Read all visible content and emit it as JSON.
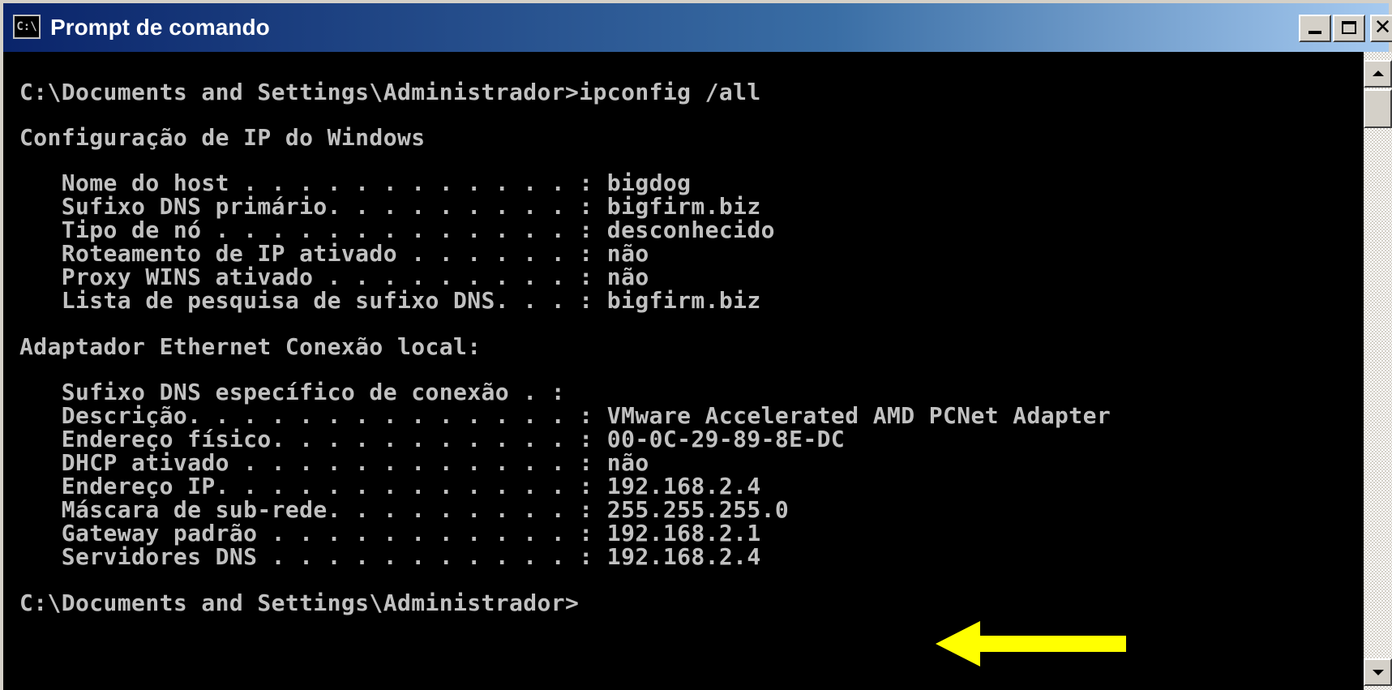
{
  "window": {
    "title": "Prompt de comando",
    "icon": "cmd-icon",
    "icon_text": "C:\\",
    "buttons": [
      "minimize-icon",
      "maximize-icon",
      "close-icon"
    ],
    "close_glyph": "✕"
  },
  "console": {
    "lines": [
      "C:\\Documents and Settings\\Administrador>ipconfig /all",
      "Configuração de IP do Windows",
      "   Nome do host . . . . . . . . . . . . : bigdog",
      "   Sufixo DNS primário. . . . . . . . . : bigfirm.biz",
      "   Tipo de nó . . . . . . . . . . . . . : desconhecido",
      "   Roteamento de IP ativado . . . . . . : não",
      "   Proxy WINS ativado . . . . . . . . . : não",
      "   Lista de pesquisa de sufixo DNS. . . : bigfirm.biz",
      "Adaptador Ethernet Conexão local:",
      "   Sufixo DNS específico de conexão . :",
      "   Descrição. . . . . . . . . . . . . . : VMware Accelerated AMD PCNet Adapter",
      "   Endereço físico. . . . . . . . . . . : 00-0C-29-89-8E-DC",
      "   DHCP ativado . . . . . . . . . . . . : não",
      "   Endereço IP. . . . . . . . . . . . . : 192.168.2.4",
      "   Máscara de sub-rede. . . . . . . . . : 255.255.255.0",
      "   Gateway padrão . . . . . . . . . . . : 192.168.2.1",
      "   Servidores DNS . . . . . . . . . . . : 192.168.2.4",
      "C:\\Documents and Settings\\Administrador>"
    ],
    "text_color": "#c0c0c0",
    "background": "#000000"
  },
  "annotation": {
    "arrow_color": "#ffff00",
    "arrow_icon": "left-arrow-icon"
  },
  "colors": {
    "titlebar_start": "#0a246a",
    "titlebar_end": "#a6caf0"
  }
}
